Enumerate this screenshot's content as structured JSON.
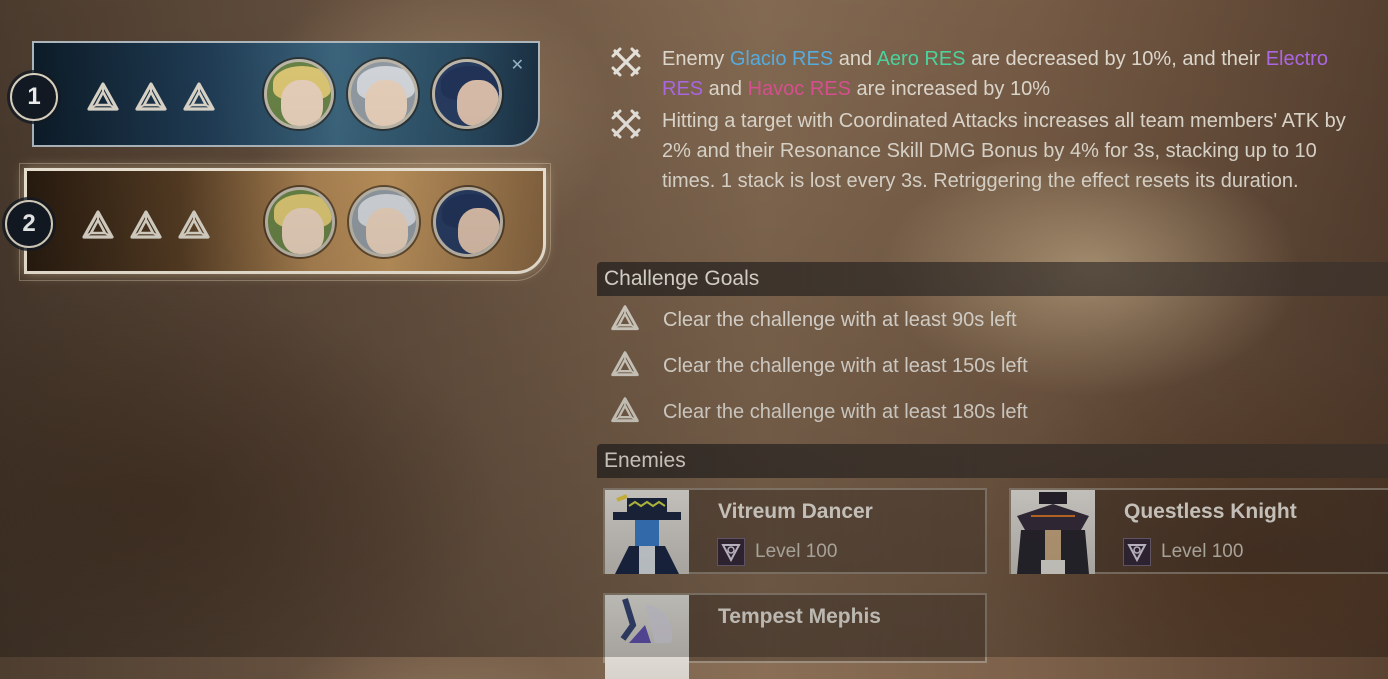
{
  "teams": [
    {
      "number": "1",
      "goal_icon": "challenge-goal-icon",
      "avatars": [
        "blonde-flower-girl",
        "silver-hair-girl",
        "blue-hair-glasses-man"
      ]
    },
    {
      "number": "2",
      "goal_icon": "challenge-goal-icon",
      "avatars": [
        "blonde-flower-girl",
        "silver-hair-girl",
        "blue-hair-glasses-man"
      ],
      "selected": true
    }
  ],
  "effects": [
    {
      "icon": "crossed-swords-icon",
      "parts": {
        "p1": "Enemy ",
        "glacio": "Glacio RES",
        "p2": " and ",
        "aero": "Aero RES",
        "p3": " are decreased by 10%, and their ",
        "electro": "Electro RES",
        "p4": " and ",
        "havoc": "Havoc RES",
        "p5": " are increased by 10%"
      }
    },
    {
      "icon": "crossed-swords-icon",
      "text": "Hitting a target with Coordinated Attacks increases all team members' ATK by 2% and their Resonance Skill DMG Bonus by 4% for 3s, stacking up to 10 times. 1 stack is lost every 3s. Retriggering the effect resets its duration."
    }
  ],
  "colors": {
    "glacio": "#5cb8ee",
    "aero": "#52e1a8",
    "electro": "#b86ef2",
    "havoc": "#e8559a"
  },
  "challenge_goals": {
    "title": "Challenge Goals",
    "items": [
      "Clear the challenge with at least 90s left",
      "Clear the challenge with at least 150s left",
      "Clear the challenge with at least 180s left"
    ]
  },
  "enemies": {
    "title": "Enemies",
    "items": [
      {
        "name": "Vitreum Dancer",
        "level": "Level 100"
      },
      {
        "name": "Questless Knight",
        "level": "Level 100"
      },
      {
        "name": "Tempest Mephis"
      }
    ]
  }
}
